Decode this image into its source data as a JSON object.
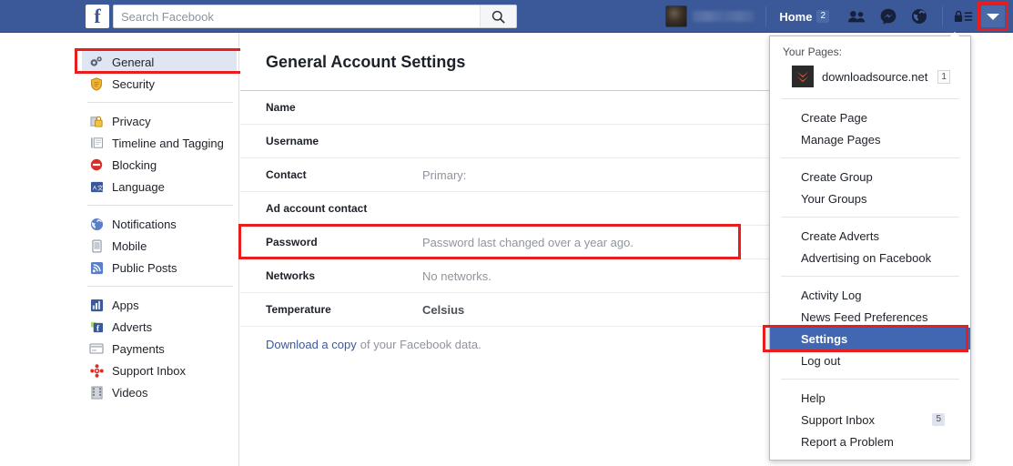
{
  "topbar": {
    "logo_letter": "f",
    "logo_icon": "facebook-logo-icon",
    "search": {
      "placeholder": "Search Facebook",
      "value": "",
      "icon": "search-icon"
    },
    "profile": {
      "avatar_icon": "user-avatar",
      "name": ""
    },
    "home": {
      "label": "Home",
      "count": "2"
    },
    "icons": [
      {
        "name": "friend-requests-icon",
        "glyph": "friend-requests"
      },
      {
        "name": "messenger-icon",
        "glyph": "messenger"
      },
      {
        "name": "notifications-globe-icon",
        "glyph": "globe"
      },
      {
        "name": "privacy-lock-icon",
        "glyph": "lock"
      }
    ],
    "account_caret_icon": "chevron-down-icon"
  },
  "sidebar": {
    "groups": [
      {
        "items": [
          {
            "label": "General",
            "icon": "gears-icon",
            "selected": true,
            "highlighted": true
          },
          {
            "label": "Security",
            "icon": "shield-icon",
            "selected": false,
            "highlighted": false
          }
        ]
      },
      {
        "items": [
          {
            "label": "Privacy",
            "icon": "padlock-icon",
            "selected": false,
            "highlighted": false
          },
          {
            "label": "Timeline and Tagging",
            "icon": "timeline-icon",
            "selected": false,
            "highlighted": false
          },
          {
            "label": "Blocking",
            "icon": "blocking-icon",
            "selected": false,
            "highlighted": false
          },
          {
            "label": "Language",
            "icon": "language-icon",
            "selected": false,
            "highlighted": false
          }
        ]
      },
      {
        "items": [
          {
            "label": "Notifications",
            "icon": "notifications-globe-icon",
            "selected": false,
            "highlighted": false
          },
          {
            "label": "Mobile",
            "icon": "mobile-phone-icon",
            "selected": false,
            "highlighted": false
          },
          {
            "label": "Public Posts",
            "icon": "rss-icon",
            "selected": false,
            "highlighted": false
          }
        ]
      },
      {
        "items": [
          {
            "label": "Apps",
            "icon": "apps-icon",
            "selected": false,
            "highlighted": false
          },
          {
            "label": "Adverts",
            "icon": "adverts-icon",
            "selected": false,
            "highlighted": false
          },
          {
            "label": "Payments",
            "icon": "payments-card-icon",
            "selected": false,
            "highlighted": false
          },
          {
            "label": "Support Inbox",
            "icon": "support-icon",
            "selected": false,
            "highlighted": false
          },
          {
            "label": "Videos",
            "icon": "videos-filmstrip-icon",
            "selected": false,
            "highlighted": false
          }
        ]
      }
    ]
  },
  "main": {
    "title": "General Account Settings",
    "rows": [
      {
        "label": "Name",
        "value": "",
        "highlighted": false,
        "value_dark": false
      },
      {
        "label": "Username",
        "value": "",
        "highlighted": false,
        "value_dark": false
      },
      {
        "label": "Contact",
        "value": "Primary:",
        "highlighted": false,
        "value_dark": false
      },
      {
        "label": "Ad account contact",
        "value": "",
        "highlighted": false,
        "value_dark": false
      },
      {
        "label": "Password",
        "value": "Password last changed over a year ago.",
        "highlighted": true,
        "value_dark": false
      },
      {
        "label": "Networks",
        "value": "No networks.",
        "highlighted": false,
        "value_dark": false
      },
      {
        "label": "Temperature",
        "value": "Celsius",
        "highlighted": false,
        "value_dark": true
      }
    ],
    "download": {
      "link_text": "Download a copy",
      "rest_text": "of your Facebook data."
    }
  },
  "dropdown": {
    "pages_title": "Your Pages:",
    "page": {
      "name": "downloadsource.net",
      "badge": "1",
      "icon": "page-chevrons-icon"
    },
    "groups": [
      {
        "items": [
          {
            "label": "Create Page",
            "badge": "",
            "active": false,
            "highlighted": false
          },
          {
            "label": "Manage Pages",
            "badge": "",
            "active": false,
            "highlighted": false
          }
        ]
      },
      {
        "items": [
          {
            "label": "Create Group",
            "badge": "",
            "active": false,
            "highlighted": false
          },
          {
            "label": "Your Groups",
            "badge": "",
            "active": false,
            "highlighted": false
          }
        ]
      },
      {
        "items": [
          {
            "label": "Create Adverts",
            "badge": "",
            "active": false,
            "highlighted": false
          },
          {
            "label": "Advertising on Facebook",
            "badge": "",
            "active": false,
            "highlighted": false
          }
        ]
      },
      {
        "items": [
          {
            "label": "Activity Log",
            "badge": "",
            "active": false,
            "highlighted": false
          },
          {
            "label": "News Feed Preferences",
            "badge": "",
            "active": false,
            "highlighted": false
          },
          {
            "label": "Settings",
            "badge": "",
            "active": true,
            "highlighted": true
          },
          {
            "label": "Log out",
            "badge": "",
            "active": false,
            "highlighted": false
          }
        ]
      },
      {
        "items": [
          {
            "label": "Help",
            "badge": "",
            "active": false,
            "highlighted": false
          },
          {
            "label": "Support Inbox",
            "badge": "5",
            "active": false,
            "highlighted": false
          },
          {
            "label": "Report a Problem",
            "badge": "",
            "active": false,
            "highlighted": false
          }
        ]
      }
    ]
  },
  "colors": {
    "brand_blue": "#3b5998",
    "highlight_red": "#e81d1d",
    "active_blue": "#4267b2",
    "selected_sidebar": "#dfe5f2"
  }
}
